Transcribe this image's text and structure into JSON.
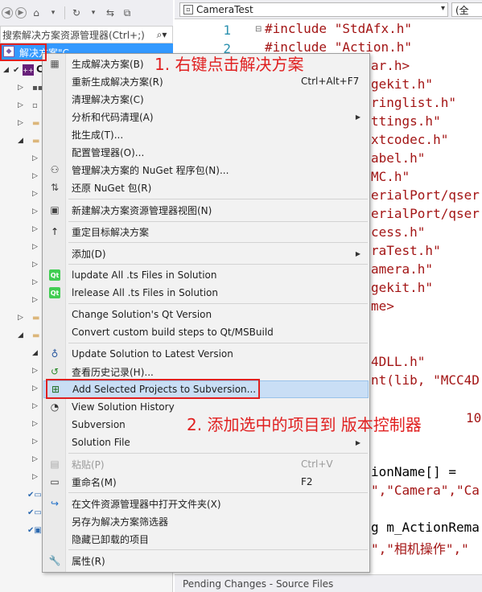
{
  "toolbar": {
    "icons": [
      "back-icon",
      "forward-icon",
      "home-icon",
      "history-icon",
      "sync-icon",
      "collapse-icon"
    ]
  },
  "search": {
    "placeholder": "搜索解决方案资源管理器(Ctrl+;)"
  },
  "tree": {
    "selected_label": "解决方案\"C",
    "project_label": "C"
  },
  "editor": {
    "file_combo": "CameraTest",
    "scope_combo": "(全",
    "bottom_tab": "Pending Changes - Source Files",
    "lines": [
      {
        "ln": "1",
        "text": "#include \"StdAfx.h\""
      },
      {
        "ln": "2",
        "text": "#include \"Action.h\""
      }
    ],
    "fragments": [
      "ar.h>",
      "gekit.h\"",
      "ringlist.h\"",
      "ttings.h\"",
      "xtcodec.h\"",
      "abel.h\"",
      "MC.h\"",
      "erialPort/qser",
      "erialPort/qser",
      "cess.h\"",
      "raTest.h\"",
      "amera.h\"",
      "gekit.h\"",
      "me>",
      "4DLL.h\"",
      "nt(lib, \"MCC4D",
      "10",
      "ionName[] =",
      "\",\"Camera\",\"Ca",
      "g m_ActionRema",
      "\",\"相机操作\",\""
    ]
  },
  "menu": {
    "items": [
      {
        "label": "生成解决方案(B)",
        "icon": "build-icon"
      },
      {
        "label": "重新生成解决方案(R)",
        "shortcut": "Ctrl+Alt+F7"
      },
      {
        "label": "清理解决方案(C)"
      },
      {
        "label": "分析和代码清理(A)"
      },
      {
        "label": "批生成(T)..."
      },
      {
        "label": "配置管理器(O)..."
      },
      {
        "label": "管理解决方案的 NuGet 程序包(N)...",
        "icon": "nuget-icon"
      },
      {
        "label": "还原 NuGet 包(R)",
        "icon": "restore-icon"
      },
      {
        "label": "新建解决方案资源管理器视图(N)",
        "icon": "new-view-icon"
      },
      {
        "label": "重定目标解决方案",
        "icon": "retarget-icon"
      },
      {
        "label": "添加(D)"
      },
      {
        "label": "lupdate All .ts Files in Solution",
        "icon": "qt-icon"
      },
      {
        "label": "lrelease All .ts Files in Solution",
        "icon": "qt-icon"
      },
      {
        "label": "Change Solution's Qt Version"
      },
      {
        "label": "Convert custom build steps to Qt/MSBuild"
      },
      {
        "label": "Update Solution to Latest Version",
        "icon": "svn-update-icon"
      },
      {
        "label": "查看历史记录(H)...",
        "icon": "history-icon"
      },
      {
        "label": "Add Selected Projects to Subversion...",
        "icon": "svn-add-icon"
      },
      {
        "label": "View Solution History",
        "icon": "svn-history-icon"
      },
      {
        "label": "Subversion"
      },
      {
        "label": "Solution File"
      },
      {
        "label": "粘贴(P)",
        "shortcut": "Ctrl+V",
        "icon": "paste-icon"
      },
      {
        "label": "重命名(M)",
        "shortcut": "F2",
        "icon": "rename-icon"
      },
      {
        "label": "在文件资源管理器中打开文件夹(X)",
        "icon": "open-folder-icon"
      },
      {
        "label": "另存为解决方案筛选器"
      },
      {
        "label": "隐藏已卸载的项目"
      },
      {
        "label": "属性(R)",
        "icon": "wrench-icon"
      }
    ]
  },
  "annotations": {
    "step1": "1. 右键点击解决方案",
    "step2": "2. 添加选中的项目到 版本控制器"
  },
  "colors": {
    "selection": "#3399ff",
    "annotation": "#e02020",
    "menu_highlight": "#c9def5",
    "qt_green": "#41cd52"
  }
}
